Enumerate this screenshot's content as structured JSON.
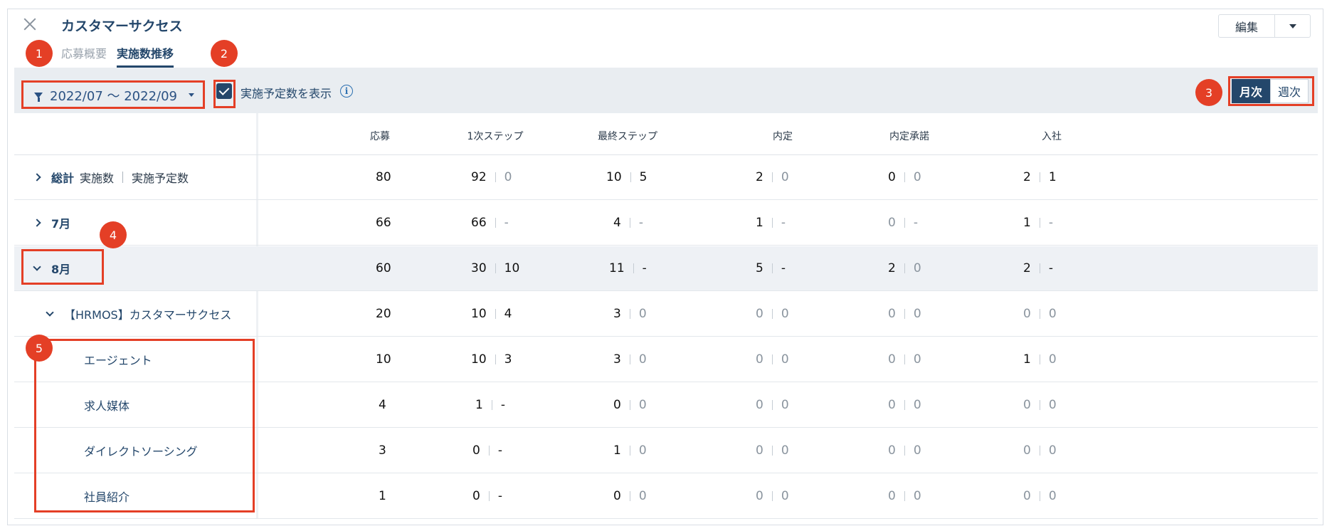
{
  "header": {
    "title": "カスタマーサクセス",
    "edit_label": "編集"
  },
  "tabs": [
    {
      "label": "応募概要",
      "active": false
    },
    {
      "label": "実施数推移",
      "active": true
    }
  ],
  "filter": {
    "date_range": "2022/07 〜 2022/09",
    "show_planned_label": "実施予定数を表示",
    "show_planned_checked": true,
    "info_icon": "i"
  },
  "period_toggle": {
    "monthly": "月次",
    "weekly": "週次",
    "selected": "月次"
  },
  "columns": [
    "応募",
    "1次ステップ",
    "最終ステップ",
    "内定",
    "内定承諾",
    "入社"
  ],
  "rows": [
    {
      "label": "総計",
      "sub1": "実施数",
      "sub2": "実施予定数",
      "expand": "collapsed",
      "apply": "80",
      "step1": [
        "92",
        "0"
      ],
      "final": [
        "10",
        "5"
      ],
      "offer": [
        "2",
        "0"
      ],
      "accept": [
        "0",
        "0"
      ],
      "join": [
        "2",
        "1"
      ]
    },
    {
      "label": "7月",
      "expand": "collapsed",
      "apply": "66",
      "step1": [
        "66",
        "-"
      ],
      "final": [
        "4",
        "-"
      ],
      "offer": [
        "1",
        "-"
      ],
      "accept": [
        "0",
        "-"
      ],
      "join": [
        "1",
        "-"
      ]
    },
    {
      "label": "8月",
      "expand": "expanded",
      "apply": "60",
      "step1": [
        "30",
        "10"
      ],
      "final": [
        "11",
        "-"
      ],
      "offer": [
        "5",
        "-"
      ],
      "accept": [
        "2",
        "0"
      ],
      "join": [
        "2",
        "-"
      ]
    },
    {
      "label": "【HRMOS】カスタマーサクセス",
      "expand": "expanded",
      "apply": "20",
      "step1": [
        "10",
        "4"
      ],
      "final": [
        "3",
        "0"
      ],
      "offer": [
        "0",
        "0"
      ],
      "accept": [
        "0",
        "0"
      ],
      "join": [
        "0",
        "0"
      ]
    },
    {
      "label": "エージェント",
      "apply": "10",
      "step1": [
        "10",
        "3"
      ],
      "final": [
        "3",
        "0"
      ],
      "offer": [
        "0",
        "0"
      ],
      "accept": [
        "0",
        "0"
      ],
      "join": [
        "1",
        "0"
      ]
    },
    {
      "label": "求人媒体",
      "apply": "4",
      "step1": [
        "1",
        "-"
      ],
      "final": [
        "0",
        "0"
      ],
      "offer": [
        "0",
        "0"
      ],
      "accept": [
        "0",
        "0"
      ],
      "join": [
        "0",
        "0"
      ]
    },
    {
      "label": "ダイレクトソーシング",
      "apply": "3",
      "step1": [
        "0",
        "-"
      ],
      "final": [
        "1",
        "0"
      ],
      "offer": [
        "0",
        "0"
      ],
      "accept": [
        "0",
        "0"
      ],
      "join": [
        "0",
        "0"
      ]
    },
    {
      "label": "社員紹介",
      "apply": "1",
      "step1": [
        "0",
        "-"
      ],
      "final": [
        "0",
        "0"
      ],
      "offer": [
        "0",
        "0"
      ],
      "accept": [
        "0",
        "0"
      ],
      "join": [
        "0",
        "0"
      ]
    }
  ],
  "annotations": [
    "1",
    "2",
    "3",
    "4",
    "5"
  ],
  "colors": {
    "brand": "#24476b",
    "annotation": "#e43f26",
    "filter_bg": "#e9edf1"
  }
}
